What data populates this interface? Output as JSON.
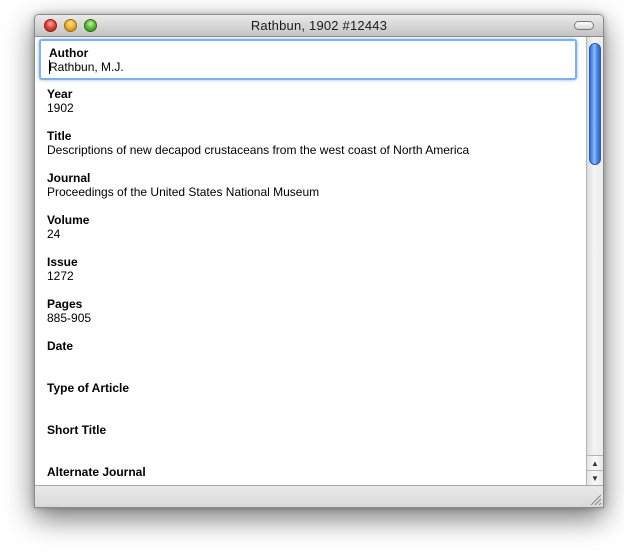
{
  "window": {
    "title": "Rathbun, 1902 #12443"
  },
  "fields": [
    {
      "label": "Author",
      "value": "Rathbun, M.J."
    },
    {
      "label": "Year",
      "value": "1902"
    },
    {
      "label": "Title",
      "value": "Descriptions of new decapod crustaceans from the west coast of North America"
    },
    {
      "label": "Journal",
      "value": "Proceedings of the United States National Museum"
    },
    {
      "label": "Volume",
      "value": "24"
    },
    {
      "label": "Issue",
      "value": "1272"
    },
    {
      "label": "Pages",
      "value": "885-905"
    },
    {
      "label": "Date",
      "value": ""
    },
    {
      "label": "Type of Article",
      "value": ""
    },
    {
      "label": "Short Title",
      "value": ""
    },
    {
      "label": "Alternate Journal",
      "value": ""
    }
  ],
  "scrollbar": {
    "up_arrow": "▲",
    "down_arrow": "▼"
  },
  "colors": {
    "focus_ring": "#7fb2ec",
    "scroll_thumb": "#4a86e4"
  },
  "icons": {
    "close": "close-icon",
    "minimize": "minimize-icon",
    "zoom": "zoom-icon",
    "toolbar_toggle": "toolbar-toggle-icon",
    "resize": "resize-grip-icon"
  }
}
